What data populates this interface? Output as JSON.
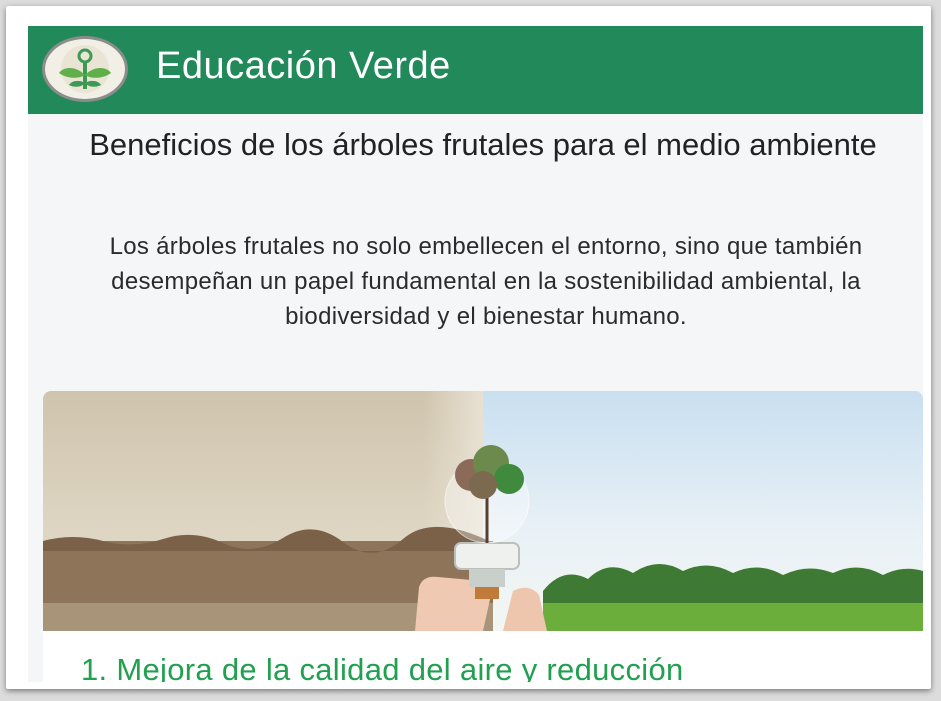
{
  "header": {
    "brand": "Educación Verde",
    "logo_icon": "sprout-logo-icon"
  },
  "article": {
    "title": "Beneficios de los árboles frutales para el medio ambiente",
    "intro": "Los árboles frutales no solo embellecen el entorno, sino que también desempeñan un papel fundamental en la sostenibilidad ambiental, la biodiversidad y el bienestar humano.",
    "hero_image": "hand-holding-lightbulb-with-tree-image",
    "sections": [
      {
        "heading": "1. Mejora de la calidad del aire y reducción"
      }
    ]
  },
  "colors": {
    "header_bg": "#21895a",
    "heading_green": "#21a050",
    "page_bg": "#f4f6f8"
  }
}
